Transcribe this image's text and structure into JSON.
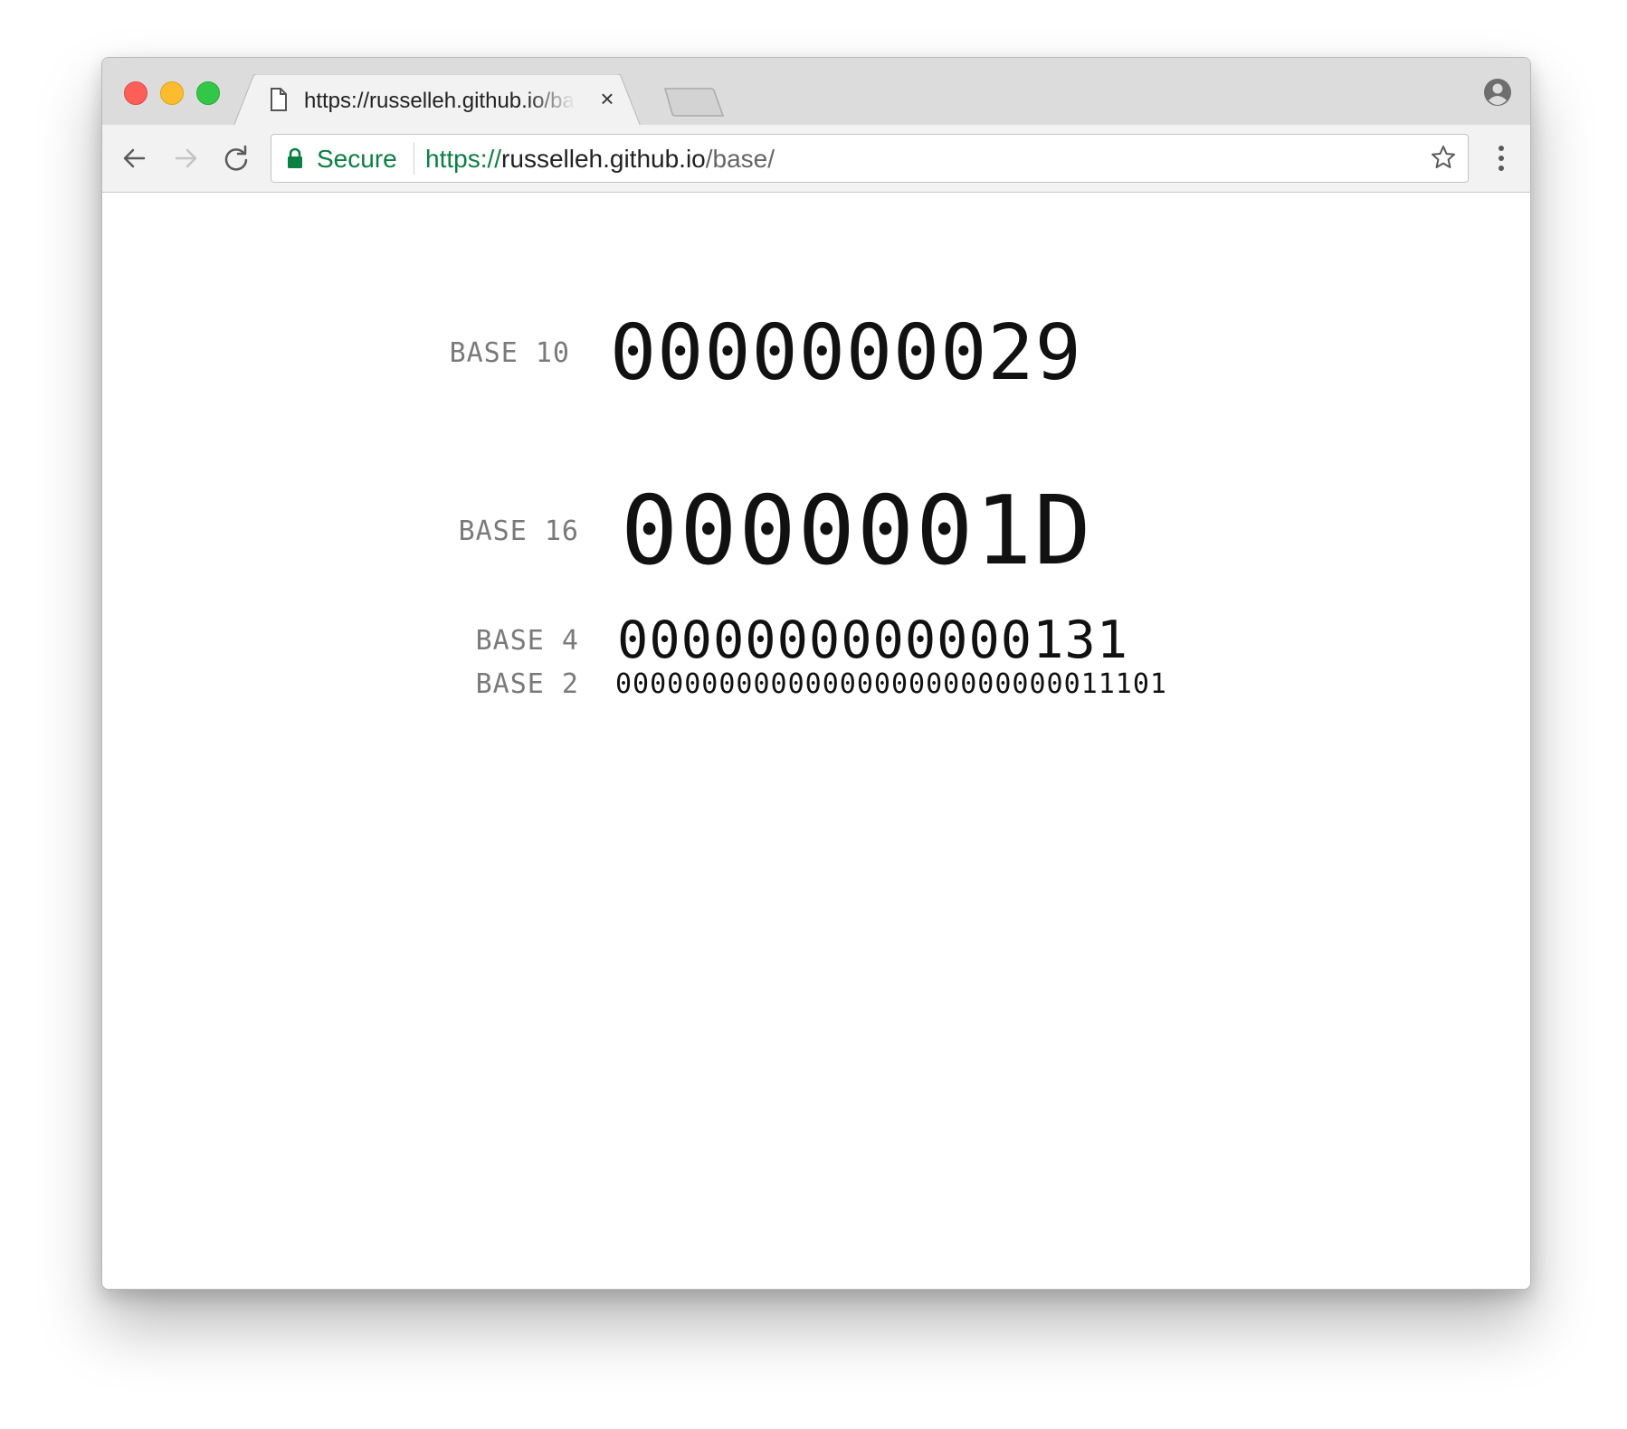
{
  "browser": {
    "tab": {
      "title": "https://russelleh.github.io/base/",
      "close_glyph": "×"
    },
    "omnibox": {
      "secure_label": "Secure",
      "url_scheme": "https://",
      "url_host": "russelleh.github.io",
      "url_path": "/base/"
    },
    "colors": {
      "secure_green": "#0b8043",
      "traffic_close": "#fc5f57",
      "traffic_min": "#fdbc2e",
      "traffic_max": "#33c748"
    }
  },
  "page": {
    "rows": [
      {
        "label": "BASE 10",
        "value": "0000000029"
      },
      {
        "label": "BASE 16",
        "value": "0000001D"
      },
      {
        "label": "BASE 4",
        "value": "0000000000000131"
      },
      {
        "label": "BASE 2",
        "value": "00000000000000000000000000011101"
      }
    ]
  }
}
